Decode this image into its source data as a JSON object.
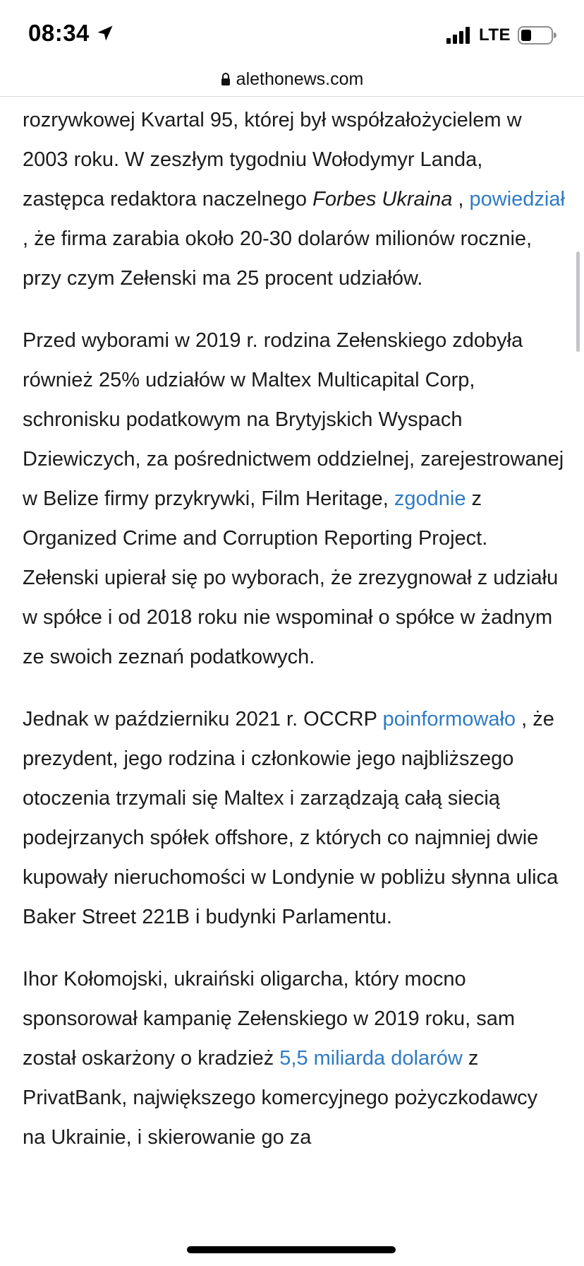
{
  "status_bar": {
    "time": "08:34",
    "network": "LTE",
    "icons": [
      "location-arrow-icon",
      "signal-bars-icon",
      "battery-low-icon"
    ]
  },
  "browser": {
    "url": "alethonews.com"
  },
  "colors": {
    "link": "#2f7bc4",
    "text": "#1c1c1e"
  },
  "article": {
    "p1": {
      "t1": "rozrywkowej Kvartal 95, której był współzałożycielem w 2003 roku. W zeszłym tygodniu Wołodymyr Landa, zastępca redaktora naczelnego ",
      "em": "Forbes Ukraina",
      "t2": " , ",
      "link": "powiedział",
      "t3": " , że firma zarabia około 20-30 dolarów milionów rocznie, przy czym Zełenski ma 25 procent udziałów."
    },
    "p2": {
      "t1": "Przed wyborami w 2019 r. rodzina Zełenskiego zdobyła również 25% udziałów w Maltex Multicapital Corp, schronisku podatkowym na Brytyjskich Wyspach Dziewiczych, za pośrednictwem oddzielnej, zarejestrowanej w Belize firmy przykrywki, Film Heritage, ",
      "link": "zgodnie",
      "t2": " z Organized Crime and Corruption Reporting Project. Zełenski upierał się po wyborach, że zrezygnował z udziału w spółce i od 2018 roku nie wspominał o spółce w żadnym ze swoich zeznań podatkowych."
    },
    "p3": {
      "t1": "Jednak w październiku 2021 r. OCCRP ",
      "link": "poinformowało",
      "t2": " , że prezydent, jego rodzina i członkowie jego najbliższego otoczenia trzymali się Maltex i zarządzają całą siecią podejrzanych spółek offshore, z których co najmniej dwie kupowały nieruchomości w Londynie w pobliżu słynna ulica Baker Street 221B i budynki Parlamentu."
    },
    "p4": {
      "t1": "Ihor Kołomojski, ukraiński oligarcha, który mocno sponsorował kampanię Zełenskiego w 2019 roku, sam został oskarżony o kradzież ",
      "link": "5,5 miliarda dolarów",
      "t2": " z PrivatBank, największego komercyjnego pożyczkodawcy na Ukrainie, i skierowanie go za"
    }
  }
}
